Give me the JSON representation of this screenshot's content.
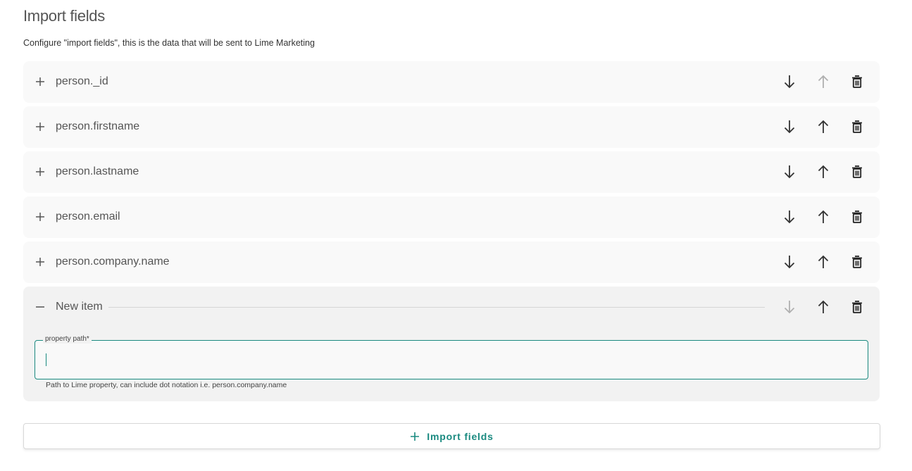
{
  "header": {
    "title": "Import fields",
    "subtitle": "Configure \"import fields\", this is the data that will be sent to Lime Marketing"
  },
  "items": [
    {
      "label": "person._id",
      "down_enabled": true,
      "up_enabled": false
    },
    {
      "label": "person.firstname",
      "down_enabled": true,
      "up_enabled": true
    },
    {
      "label": "person.lastname",
      "down_enabled": true,
      "up_enabled": true
    },
    {
      "label": "person.email",
      "down_enabled": true,
      "up_enabled": true
    },
    {
      "label": "person.company.name",
      "down_enabled": true,
      "up_enabled": true
    }
  ],
  "new_item": {
    "label": "New item",
    "down_enabled": false,
    "up_enabled": true,
    "field_label": "property path*",
    "field_value": "",
    "helper": "Path to Lime property, can include dot notation i.e. person.company.name"
  },
  "add_button": {
    "label": "Import fields"
  },
  "colors": {
    "accent": "#1a8a80",
    "icon": "#333333",
    "icon_disabled": "#b0b0b0"
  }
}
